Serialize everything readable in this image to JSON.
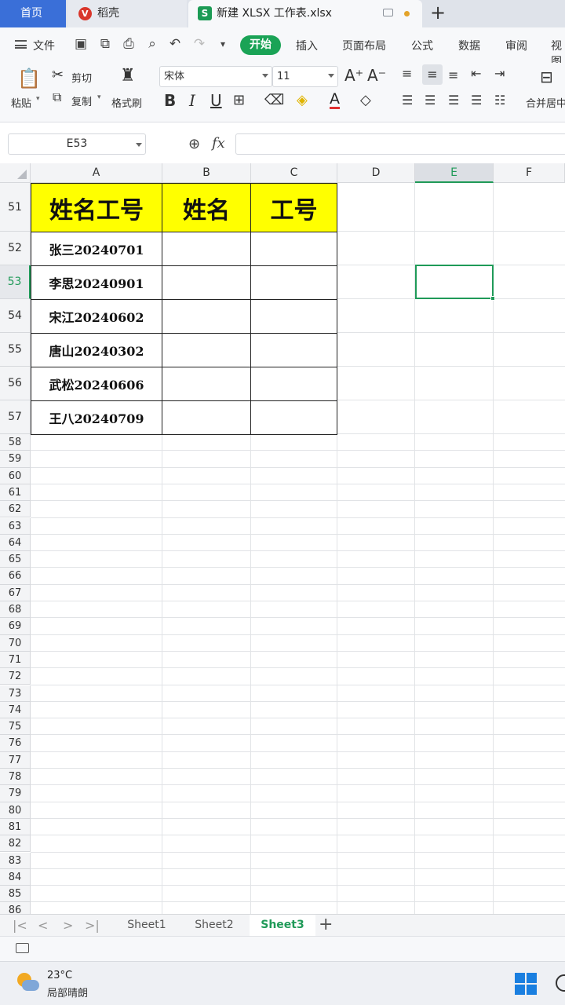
{
  "tabs": {
    "home": "首页",
    "daoke": "稻壳",
    "file": "新建 XLSX 工作表.xlsx",
    "file_icon": "S"
  },
  "menu": {
    "file": "文件",
    "start": "开始",
    "insert": "插入",
    "page_layout": "页面布局",
    "formula": "公式",
    "data": "数据",
    "review": "审阅",
    "view": "视图"
  },
  "ribbon": {
    "paste": "粘贴",
    "cut": "剪切",
    "copy": "复制",
    "format_painter": "格式刷",
    "font_name": "宋体",
    "font_size": "11",
    "merge_center": "合并居中",
    "bold": "B",
    "italic": "I",
    "underline": "U"
  },
  "formula_bar": {
    "name_box": "E53",
    "fx_label": "fx",
    "value": ""
  },
  "columns": [
    "A",
    "B",
    "C",
    "D",
    "E",
    "F"
  ],
  "active_column": "E",
  "active_row": "53",
  "rows": [
    "51",
    "52",
    "53",
    "54",
    "55",
    "56",
    "57",
    "58",
    "59",
    "60",
    "61",
    "62",
    "63",
    "64",
    "65",
    "66",
    "67",
    "68",
    "69",
    "70",
    "71",
    "72",
    "73",
    "74",
    "75",
    "76",
    "77",
    "78",
    "79",
    "80",
    "81",
    "82",
    "83",
    "84",
    "85",
    "86"
  ],
  "table": {
    "header": [
      "姓名工号",
      "姓名",
      "工号"
    ],
    "header_fill": "#ffff00",
    "data": [
      [
        "张三20240701",
        "",
        ""
      ],
      [
        "李思20240901",
        "",
        ""
      ],
      [
        "宋江20240602",
        "",
        ""
      ],
      [
        "唐山20240302",
        "",
        ""
      ],
      [
        "武松20240606",
        "",
        ""
      ],
      [
        "王八20240709",
        "",
        ""
      ]
    ]
  },
  "sheets": {
    "items": [
      "Sheet1",
      "Sheet2",
      "Sheet3"
    ],
    "active": "Sheet3"
  },
  "taskbar": {
    "temperature": "23°C",
    "weather": "局部晴朗"
  },
  "colors": {
    "accent_green": "#1f9a58",
    "home_tab_blue": "#3a6fd8"
  }
}
